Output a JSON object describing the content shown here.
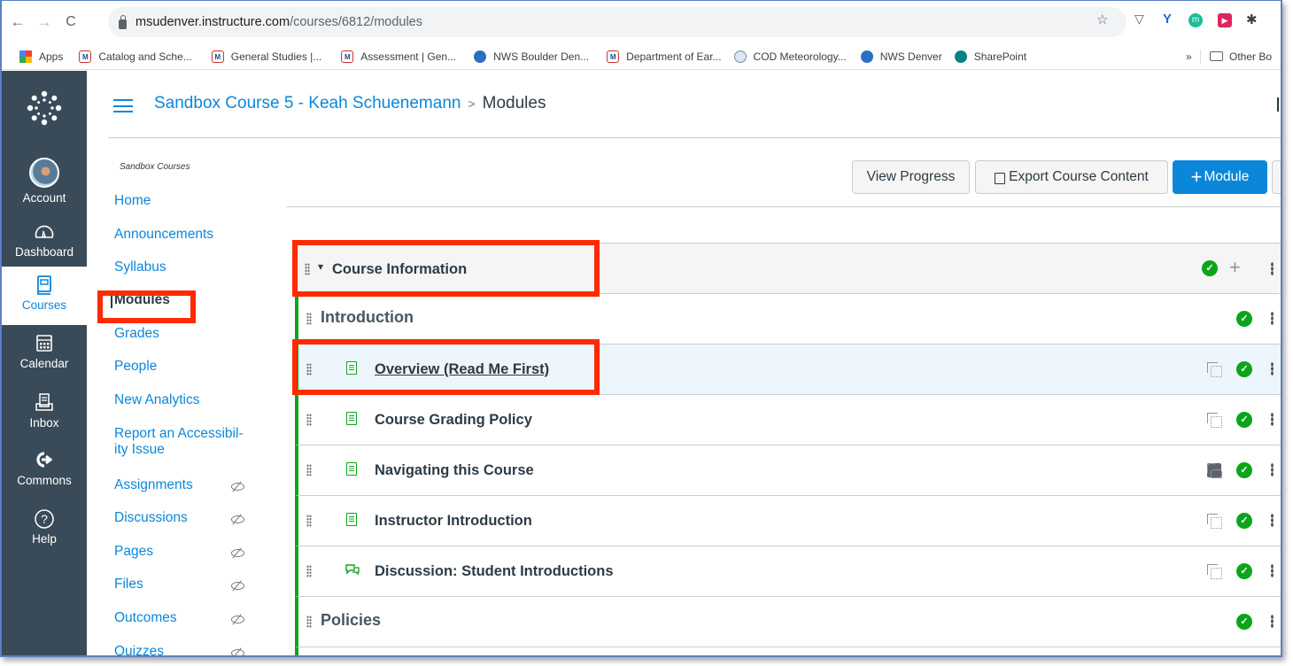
{
  "browser": {
    "nav": {
      "back": "←",
      "forward": "→",
      "reload": "C"
    },
    "url_host": "msudenver.instructure.com",
    "url_path": "/courses/6812/modules",
    "extensions": [
      "star-icon",
      "pocket-icon",
      "y-extension-icon",
      "m-extension-icon",
      "fastforward-extension-icon",
      "puzzle-icon"
    ],
    "bookmarks": [
      {
        "label": "Apps",
        "icon": "apps-grid-icon"
      },
      {
        "label": "Catalog and Sche...",
        "icon": "msu-logo-icon"
      },
      {
        "label": "General Studies |...",
        "icon": "msu-logo-icon"
      },
      {
        "label": "Assessment | Gen...",
        "icon": "msu-logo-icon"
      },
      {
        "label": "NWS Boulder Den...",
        "icon": "nws-logo-icon"
      },
      {
        "label": "Department of Ear...",
        "icon": "msu-logo-icon"
      },
      {
        "label": "COD Meteorology...",
        "icon": "cod-logo-icon"
      },
      {
        "label": "NWS Denver",
        "icon": "nws-logo-icon"
      },
      {
        "label": "SharePoint",
        "icon": "sharepoint-icon"
      }
    ],
    "overflow": "»",
    "other_bookmarks": "Other Bo"
  },
  "global_nav": [
    {
      "label": "Account",
      "icon": "avatar"
    },
    {
      "label": "Dashboard",
      "icon": "dashboard-icon"
    },
    {
      "label": "Courses",
      "icon": "courses-icon",
      "active": true
    },
    {
      "label": "Calendar",
      "icon": "calendar-icon"
    },
    {
      "label": "Inbox",
      "icon": "inbox-icon"
    },
    {
      "label": "Commons",
      "icon": "commons-icon"
    },
    {
      "label": "Help",
      "icon": "help-icon"
    }
  ],
  "breadcrumb": {
    "course": "Sandbox Course 5 - Keah Schuenemann",
    "separator": ">",
    "current": "Modules"
  },
  "course_nav": {
    "term": "Sandbox Courses",
    "items": [
      {
        "label": "Home"
      },
      {
        "label": "Announcements"
      },
      {
        "label": "Syllabus"
      },
      {
        "label": "Modules",
        "active": true
      },
      {
        "label": "Grades"
      },
      {
        "label": "People"
      },
      {
        "label": "New Analytics"
      },
      {
        "label": "Report an Accessibil-"
      },
      {
        "label": "ity Issue"
      },
      {
        "label": "Assignments",
        "hidden": true
      },
      {
        "label": "Discussions",
        "hidden": true
      },
      {
        "label": "Pages",
        "hidden": true
      },
      {
        "label": "Files",
        "hidden": true
      },
      {
        "label": "Outcomes",
        "hidden": true
      },
      {
        "label": "Quizzes",
        "hidden": true
      }
    ]
  },
  "toolbar": {
    "view_progress": "View Progress",
    "export": "Export Course Content",
    "add_module": "Module",
    "add_module_icon": "+"
  },
  "module": {
    "title": "Course Information",
    "collapse_icon": "▾",
    "rows": [
      {
        "type": "subheader",
        "title": "Introduction",
        "published": true
      },
      {
        "type": "page",
        "title": "Overview (Read Me First)",
        "published": true,
        "duplicate": true,
        "highlighted": true
      },
      {
        "type": "page",
        "title": "Course Grading Policy",
        "published": true,
        "duplicate": true
      },
      {
        "type": "page",
        "title": "Navigating this Course",
        "published": true,
        "duplicate": "locked"
      },
      {
        "type": "page",
        "title": "Instructor Introduction",
        "published": true,
        "duplicate": true
      },
      {
        "type": "discussion",
        "title": "Discussion: Student Introductions",
        "published": true,
        "duplicate": true
      },
      {
        "type": "subheader",
        "title": "Policies",
        "published": true
      }
    ]
  },
  "colors": {
    "canvas_blue": "#0b87da",
    "nav_bg": "#394b58",
    "publish_green": "#0ba51b",
    "annotation_red": "#ff2a00"
  }
}
